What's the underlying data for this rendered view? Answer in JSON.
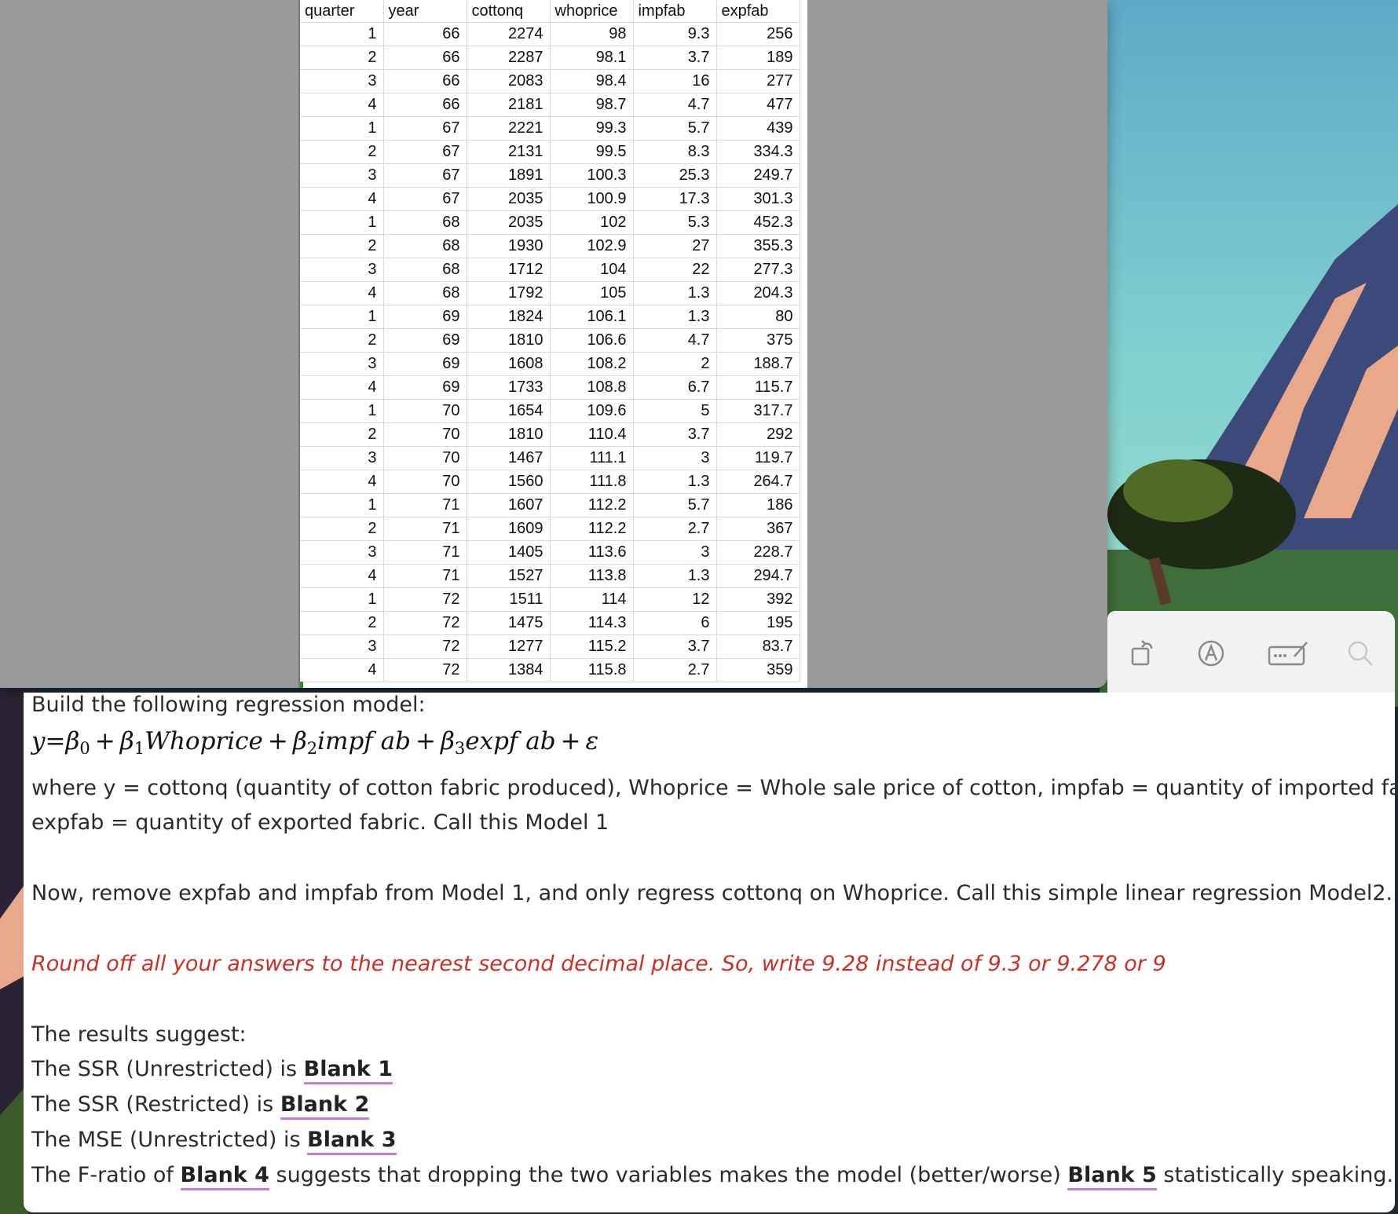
{
  "spreadsheet": {
    "headers": [
      "quarter",
      "year",
      "cottonq",
      "whoprice",
      "impfab",
      "expfab"
    ],
    "rows": [
      [
        "1",
        "66",
        "2274",
        "98",
        "9.3",
        "256"
      ],
      [
        "2",
        "66",
        "2287",
        "98.1",
        "3.7",
        "189"
      ],
      [
        "3",
        "66",
        "2083",
        "98.4",
        "16",
        "277"
      ],
      [
        "4",
        "66",
        "2181",
        "98.7",
        "4.7",
        "477"
      ],
      [
        "1",
        "67",
        "2221",
        "99.3",
        "5.7",
        "439"
      ],
      [
        "2",
        "67",
        "2131",
        "99.5",
        "8.3",
        "334.3"
      ],
      [
        "3",
        "67",
        "1891",
        "100.3",
        "25.3",
        "249.7"
      ],
      [
        "4",
        "67",
        "2035",
        "100.9",
        "17.3",
        "301.3"
      ],
      [
        "1",
        "68",
        "2035",
        "102",
        "5.3",
        "452.3"
      ],
      [
        "2",
        "68",
        "1930",
        "102.9",
        "27",
        "355.3"
      ],
      [
        "3",
        "68",
        "1712",
        "104",
        "22",
        "277.3"
      ],
      [
        "4",
        "68",
        "1792",
        "105",
        "1.3",
        "204.3"
      ],
      [
        "1",
        "69",
        "1824",
        "106.1",
        "1.3",
        "80"
      ],
      [
        "2",
        "69",
        "1810",
        "106.6",
        "4.7",
        "375"
      ],
      [
        "3",
        "69",
        "1608",
        "108.2",
        "2",
        "188.7"
      ],
      [
        "4",
        "69",
        "1733",
        "108.8",
        "6.7",
        "115.7"
      ],
      [
        "1",
        "70",
        "1654",
        "109.6",
        "5",
        "317.7"
      ],
      [
        "2",
        "70",
        "1810",
        "110.4",
        "3.7",
        "292"
      ],
      [
        "3",
        "70",
        "1467",
        "111.1",
        "3",
        "119.7"
      ],
      [
        "4",
        "70",
        "1560",
        "111.8",
        "1.3",
        "264.7"
      ],
      [
        "1",
        "71",
        "1607",
        "112.2",
        "5.7",
        "186"
      ],
      [
        "2",
        "71",
        "1609",
        "112.2",
        "2.7",
        "367"
      ],
      [
        "3",
        "71",
        "1405",
        "113.6",
        "3",
        "228.7"
      ],
      [
        "4",
        "71",
        "1527",
        "113.8",
        "1.3",
        "294.7"
      ],
      [
        "1",
        "72",
        "1511",
        "114",
        "12",
        "392"
      ],
      [
        "2",
        "72",
        "1475",
        "114.3",
        "6",
        "195"
      ],
      [
        "3",
        "72",
        "1277",
        "115.2",
        "3.7",
        "83.7"
      ],
      [
        "4",
        "72",
        "1384",
        "115.8",
        "2.7",
        "359"
      ]
    ]
  },
  "toolbar": {
    "icons": [
      "rotate-icon",
      "markup-icon",
      "signature-icon",
      "search-icon"
    ]
  },
  "doc": {
    "intro": "Build the following regression model:",
    "formula": {
      "lhs": "y",
      "eq": "=",
      "b0": "β",
      "b0_sub": "0",
      "plus1": "+",
      "b1": "β",
      "b1_sub": "1",
      "v1": "Whoprice",
      "plus2": "+",
      "b2": "β",
      "b2_sub": "2",
      "v2": "impf ab",
      "plus3": "+",
      "b3": "β",
      "b3_sub": "3",
      "v3": "expf ab",
      "plus4": "+",
      "eps": "ε"
    },
    "where_line1": "where y = cottonq (quantity of cotton fabric produced), Whoprice = Whole sale price of cotton, impfab = quantity of imported fabric,",
    "where_line2": "expfab = quantity of exported fabric. Call this Model 1",
    "now_line": "Now, remove expfab and impfab from Model 1, and only regress cottonq on Whoprice. Call this simple linear regression Model2.",
    "rounding_note": "Round off all your answers to the nearest second decimal place. So, write 9.28 instead of 9.3 or 9.278 or 9",
    "results_intro": "The results suggest:",
    "q1_prefix": "The SSR (Unrestricted) is ",
    "blank1": "Blank 1",
    "q2_prefix": "The SSR (Restricted) is ",
    "blank2": "Blank 2",
    "q3_prefix": "The MSE (Unrestricted) is ",
    "blank3": "Blank 3",
    "q4_prefix": "The F-ratio of ",
    "blank4": "Blank 4",
    "q4_middle": " suggests that dropping the two variables makes the model (better/worse) ",
    "blank5": "Blank 5",
    "q4_suffix": " statistically speaking."
  }
}
